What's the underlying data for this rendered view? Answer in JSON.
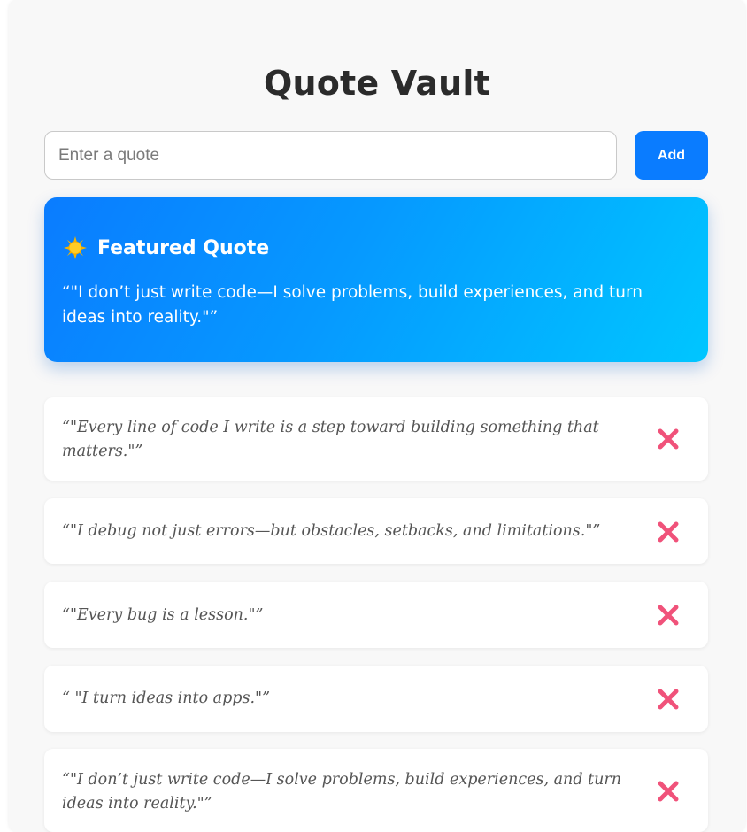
{
  "app": {
    "title": "Quote Vault"
  },
  "input": {
    "placeholder": "Enter a quote",
    "value": ""
  },
  "add_button": {
    "label": "Add",
    "color": "#0a7cff"
  },
  "featured": {
    "icon": "sun-icon",
    "heading": "Featured Quote",
    "text": "“\"I don’t just write code—I solve problems, build experiences, and turn ideas into reality.\"”"
  },
  "quotes": [
    {
      "text": "“\"Every line of code I write is a step toward building something that matters.\"”"
    },
    {
      "text": "“\"I debug not just errors—but obstacles, setbacks, and limitations.\"”"
    },
    {
      "text": "“\"Every bug is a lesson.\"”"
    },
    {
      "text": "“ \"I turn ideas into apps.\"”"
    },
    {
      "text": "“\"I don’t just write code—I solve problems, build experiences, and turn ideas into reality.\"”"
    }
  ],
  "delete_icon": {
    "name": "cross-mark-icon",
    "color": "#f0527a"
  }
}
